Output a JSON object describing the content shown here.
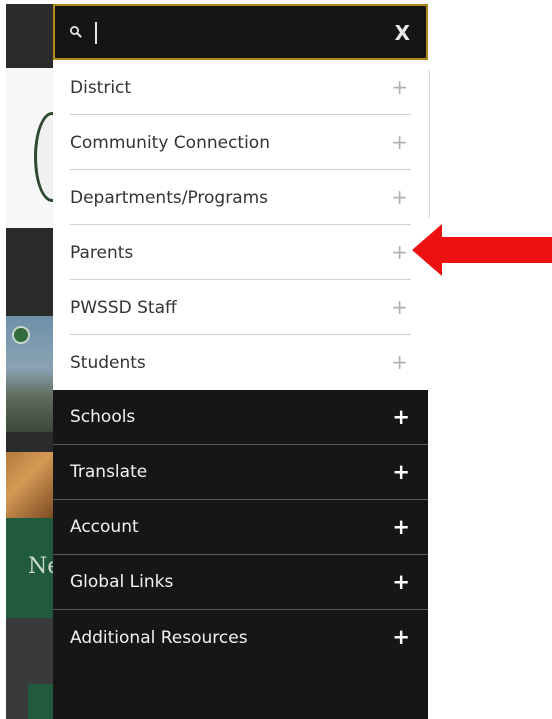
{
  "search": {
    "placeholder": "",
    "close_label": "X"
  },
  "menu": {
    "primary_items": [
      {
        "label": "District",
        "expand": "+"
      },
      {
        "label": "Community Connection",
        "expand": "+"
      },
      {
        "label": "Departments/Programs",
        "expand": "+"
      },
      {
        "label": "Parents",
        "expand": "+"
      },
      {
        "label": "PWSSD Staff",
        "expand": "+"
      },
      {
        "label": "Students",
        "expand": "+"
      }
    ],
    "secondary_items": [
      {
        "label": "Schools",
        "expand": "+"
      },
      {
        "label": "Translate",
        "expand": "+"
      },
      {
        "label": "Account",
        "expand": "+"
      },
      {
        "label": "Global Links",
        "expand": "+"
      },
      {
        "label": "Additional Resources",
        "expand": "+"
      }
    ]
  },
  "background": {
    "partial_text": "Ne"
  },
  "colors": {
    "menu_dark": "#161616",
    "search_border": "#b38a17",
    "annotation_arrow": "#ee1111",
    "background_green": "#1f5b3c"
  }
}
